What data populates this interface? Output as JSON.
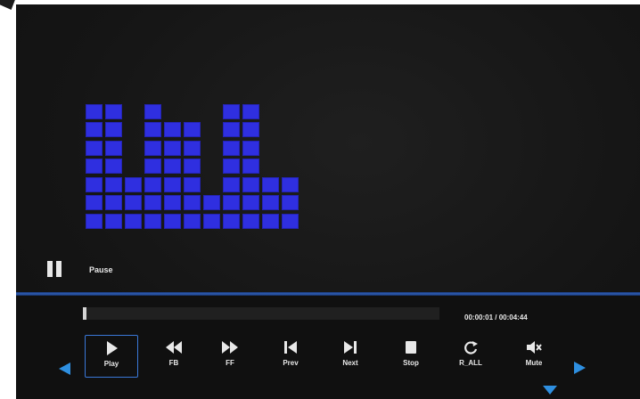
{
  "status": {
    "state_label": "Pause"
  },
  "progress": {
    "fraction": 0.01,
    "elapsed": "00:00:01",
    "total": "00:04:44",
    "separator": "/",
    "time_text": "00:00:01 / 00:04:44"
  },
  "visualizer": {
    "levels": [
      7,
      7,
      3,
      7,
      6,
      6,
      2,
      7,
      7,
      3,
      3
    ],
    "color": "#2f2fe0"
  },
  "controls": [
    {
      "id": "play",
      "label": "Play",
      "icon": "play-icon",
      "selected": true
    },
    {
      "id": "fb",
      "label": "FB",
      "icon": "fast-backward-icon",
      "selected": false
    },
    {
      "id": "ff",
      "label": "FF",
      "icon": "fast-forward-icon",
      "selected": false
    },
    {
      "id": "prev",
      "label": "Prev",
      "icon": "skip-previous-icon",
      "selected": false
    },
    {
      "id": "next",
      "label": "Next",
      "icon": "skip-next-icon",
      "selected": false
    },
    {
      "id": "stop",
      "label": "Stop",
      "icon": "stop-icon",
      "selected": false
    },
    {
      "id": "r_all",
      "label": "R_ALL",
      "icon": "repeat-all-icon",
      "selected": false
    },
    {
      "id": "mute",
      "label": "Mute",
      "icon": "mute-icon",
      "selected": false
    }
  ],
  "nav": {
    "left_icon": "arrow-left-icon",
    "right_icon": "arrow-right-icon",
    "down_icon": "arrow-down-icon"
  },
  "colors": {
    "accent": "#3a78d8",
    "text": "#e8e8e8",
    "background": "#151515"
  }
}
